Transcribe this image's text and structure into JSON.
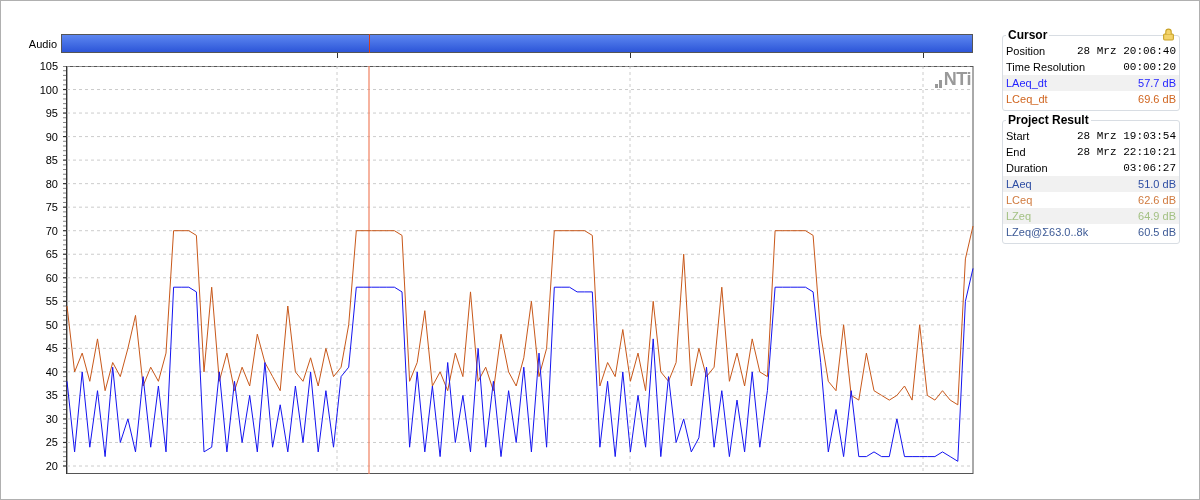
{
  "overview": {
    "label": "Audio"
  },
  "plot": {
    "logo": "NTi",
    "chart_data": {
      "type": "line",
      "grid": true,
      "ylim": [
        20,
        105
      ],
      "yticks": [
        105,
        100,
        95,
        90,
        85,
        80,
        75,
        70,
        65,
        60,
        55,
        50,
        45,
        40,
        35,
        30,
        25,
        20
      ],
      "series": [
        {
          "color": "#c8581a",
          "values": [
            54,
            40,
            44,
            38,
            47,
            36,
            42,
            39,
            45,
            52,
            37,
            41,
            38,
            44,
            70,
            70,
            70,
            69,
            40,
            58,
            38,
            44,
            36,
            41,
            37,
            48,
            42,
            39,
            36,
            54,
            40,
            38,
            43,
            37,
            45,
            39,
            41,
            50,
            70,
            70,
            70,
            70,
            70,
            70,
            69,
            38,
            42,
            53,
            37,
            40,
            36,
            44,
            39,
            57,
            38,
            41,
            36,
            48,
            40,
            37,
            43,
            55,
            39,
            45,
            70,
            70,
            70,
            70,
            70,
            69,
            37,
            42,
            39,
            49,
            38,
            44,
            36,
            55,
            40,
            38,
            42,
            65,
            37,
            45,
            39,
            41,
            58,
            38,
            44,
            37,
            47,
            40,
            39,
            70,
            70,
            70,
            70,
            70,
            69,
            48,
            38,
            36,
            50,
            35,
            34,
            44,
            36,
            35,
            34,
            35,
            37,
            34,
            50,
            35,
            34,
            36,
            34,
            33,
            64,
            71
          ]
        },
        {
          "color": "#1414f0",
          "values": [
            38,
            23,
            40,
            24,
            36,
            22,
            41,
            25,
            30,
            23,
            39,
            24,
            37,
            23,
            58,
            58,
            58,
            57,
            23,
            24,
            40,
            23,
            38,
            25,
            35,
            23,
            42,
            24,
            33,
            23,
            37,
            25,
            40,
            23,
            36,
            24,
            39,
            41,
            58,
            58,
            58,
            58,
            58,
            58,
            57,
            24,
            40,
            23,
            37,
            22,
            42,
            25,
            35,
            23,
            45,
            24,
            38,
            22,
            36,
            25,
            41,
            23,
            44,
            24,
            58,
            58,
            58,
            57,
            57,
            57,
            24,
            38,
            22,
            40,
            23,
            35,
            24,
            47,
            22,
            39,
            25,
            30,
            23,
            26,
            41,
            24,
            36,
            22,
            34,
            23,
            40,
            24,
            36,
            58,
            58,
            58,
            58,
            58,
            57,
            42,
            23,
            32,
            22,
            36,
            22,
            22,
            23,
            22,
            22,
            30,
            22,
            22,
            22,
            22,
            22,
            23,
            22,
            21,
            55,
            62
          ]
        }
      ]
    }
  },
  "panels": [
    {
      "title": "Cursor",
      "locked": true,
      "rows": [
        {
          "kind": "time",
          "label": "Position",
          "value": "28 Mrz 20:06:40"
        },
        {
          "kind": "time",
          "label": "Time Resolution",
          "value": "00:00:20"
        },
        {
          "kind": "level",
          "label": "LAeq_dt",
          "value": "57.7 dB",
          "color": "#1f1fff"
        },
        {
          "kind": "level",
          "label": "LCeq_dt",
          "value": "69.6 dB",
          "color": "#d0651f"
        }
      ]
    },
    {
      "title": "Project Result",
      "rows": [
        {
          "kind": "time",
          "label": "Start",
          "value": "28 Mrz 19:03:54"
        },
        {
          "kind": "time",
          "label": "End",
          "value": "28 Mrz 22:10:21"
        },
        {
          "kind": "time",
          "label": "Duration",
          "value": "03:06:27"
        },
        {
          "kind": "level",
          "label": "LAeq",
          "value": "51.0 dB",
          "color": "#2d4da3"
        },
        {
          "kind": "level",
          "label": "LCeq",
          "value": "62.6 dB",
          "color": "#d07a3e"
        },
        {
          "kind": "level",
          "label": "LZeq",
          "value": "64.9 dB",
          "color": "#a3c183"
        },
        {
          "kind": "level",
          "label": "LZeq@Σ63.0..8k",
          "value": "60.5 dB",
          "color": "#3d5a96"
        }
      ]
    }
  ]
}
